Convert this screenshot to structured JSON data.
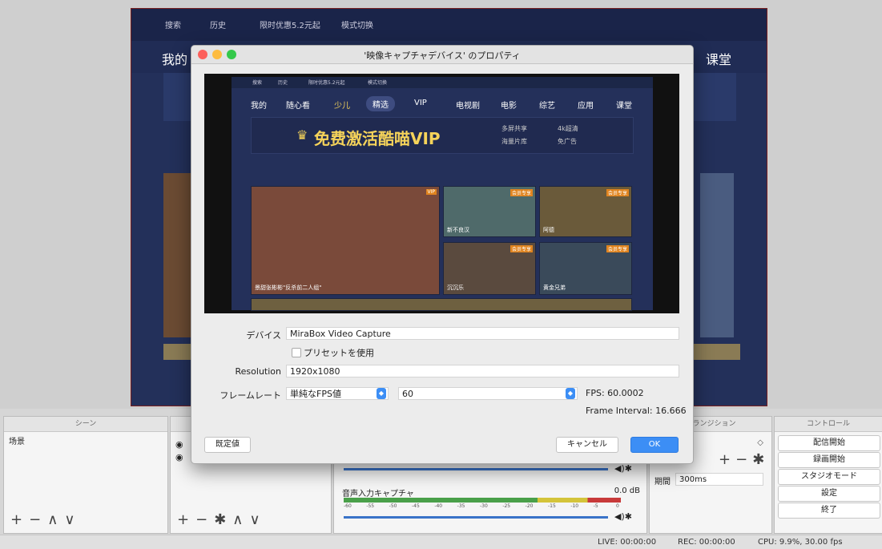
{
  "preview": {
    "topbar": [
      "搜索",
      "历史",
      "限时优惠5.2元起",
      "模式切换"
    ],
    "nav_left": "我的",
    "nav_right": "课堂"
  },
  "dialog": {
    "title": "'映像キャプチャデバイス' のプロパティ",
    "screen": {
      "topbar": [
        "搜索",
        "历史",
        "限时优惠5.2元起",
        "模式切换"
      ],
      "nav": [
        "我的",
        "随心看",
        "少儿",
        "精选",
        "VIP",
        "电视剧",
        "电影",
        "综艺",
        "应用",
        "课堂"
      ],
      "banner_main": "免费激活酷喵VIP",
      "banner_features": [
        "多屏共享",
        "4k超清",
        "海量片库",
        "免广告"
      ],
      "tile_main_caption": "景甜张彬彬\"反杀前二人组\"",
      "tile_main_badge": "VIP",
      "tile_captions": [
        "新不良汉",
        "阿德",
        "沉沉乐",
        "黄金兄弟"
      ],
      "tile_badge": "会员专享"
    },
    "fields": {
      "device_label": "デバイス",
      "device_value": "MiraBox Video Capture",
      "preset_label": "プリセットを使用",
      "resolution_label": "Resolution",
      "resolution_value": "1920x1080",
      "framerate_label": "フレームレート",
      "framerate_mode": "単純なFPS値",
      "framerate_value": "60",
      "fps_readout": "FPS: 60.0002",
      "frame_interval": "Frame Interval: 16.666"
    },
    "buttons": {
      "defaults": "既定値",
      "cancel": "キャンセル",
      "ok": "OK"
    }
  },
  "docks": {
    "scenes_title": "シーン",
    "scene_item": "场景",
    "transitions_title": "トランジション",
    "duration_label": "期間",
    "duration_value": "300ms",
    "controls_title": "コントロール",
    "controls": [
      "配信開始",
      "録画開始",
      "スタジオモード",
      "設定",
      "終了"
    ],
    "mixer_source": "音声入力キャプチャ",
    "mixer_level": "0.0 dB",
    "mixer_ticks": [
      "-60",
      "-55",
      "-50",
      "-45",
      "-40",
      "-35",
      "-30",
      "-25",
      "-20",
      "-15",
      "-10",
      "-5",
      "0"
    ]
  },
  "status": {
    "live": "LIVE: 00:00:00",
    "rec": "REC: 00:00:00",
    "cpu": "CPU: 9.9%, 30.00 fps"
  },
  "colors": {
    "accent": "#3c8ef5",
    "close": "#fc605b",
    "minimize": "#fdbc40",
    "zoom": "#34c84a",
    "vip_gold": "#f5d35a"
  }
}
